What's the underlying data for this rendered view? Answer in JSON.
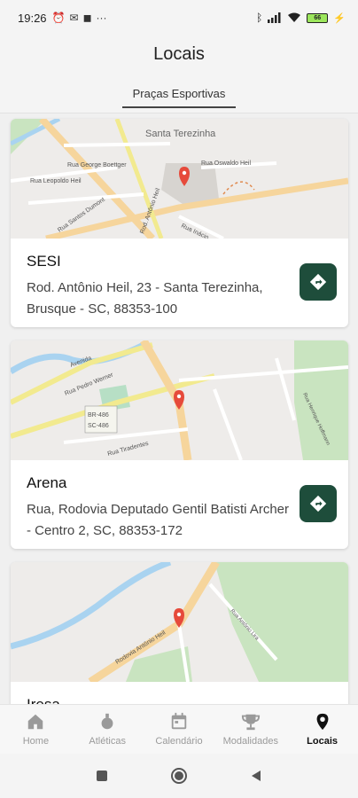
{
  "status_bar": {
    "time": "19:26",
    "battery": "66"
  },
  "header": {
    "title": "Locais",
    "tab": "Praças Esportivas"
  },
  "places": [
    {
      "name": "SESI",
      "address": " Rod. Antônio Heil, 23 - Santa Terezinha, Brusque - SC, 88353-100",
      "map_labels": [
        "Santa Terezinha",
        "Rua George Boettger",
        "Rua Oswaldo Heil",
        "Rua Leopoldo Heil",
        "Rua Santos Dumont",
        "Rod. Antônio Heil",
        "Rua Inácio"
      ]
    },
    {
      "name": "Arena",
      "address": "Rua, Rodovia Deputado Gentil Batisti Archer - Centro 2, SC, 88353-172",
      "map_labels": [
        "Avenida",
        "Rua Pedro Werner",
        "BR-486",
        "SC-486",
        "Rua Tiradentes",
        "Rua Henrique Hoffmann"
      ]
    },
    {
      "name": "Iresa",
      "address": "",
      "map_labels": [
        "Rodovia Antônio Heil",
        "Rua Antônio Lira"
      ]
    }
  ],
  "bottom_nav": {
    "items": [
      {
        "label": "Home",
        "icon": "home-icon"
      },
      {
        "label": "Atléticas",
        "icon": "medal-icon"
      },
      {
        "label": "Calendário",
        "icon": "calendar-icon"
      },
      {
        "label": "Modalidades",
        "icon": "trophy-icon"
      },
      {
        "label": "Locais",
        "icon": "location-pin-icon",
        "active": true
      }
    ]
  },
  "colors": {
    "accent": "#1e4d3b",
    "map_road": "#f6d59c",
    "map_park": "#c9e4c0",
    "map_water": "#a9d3f0"
  }
}
